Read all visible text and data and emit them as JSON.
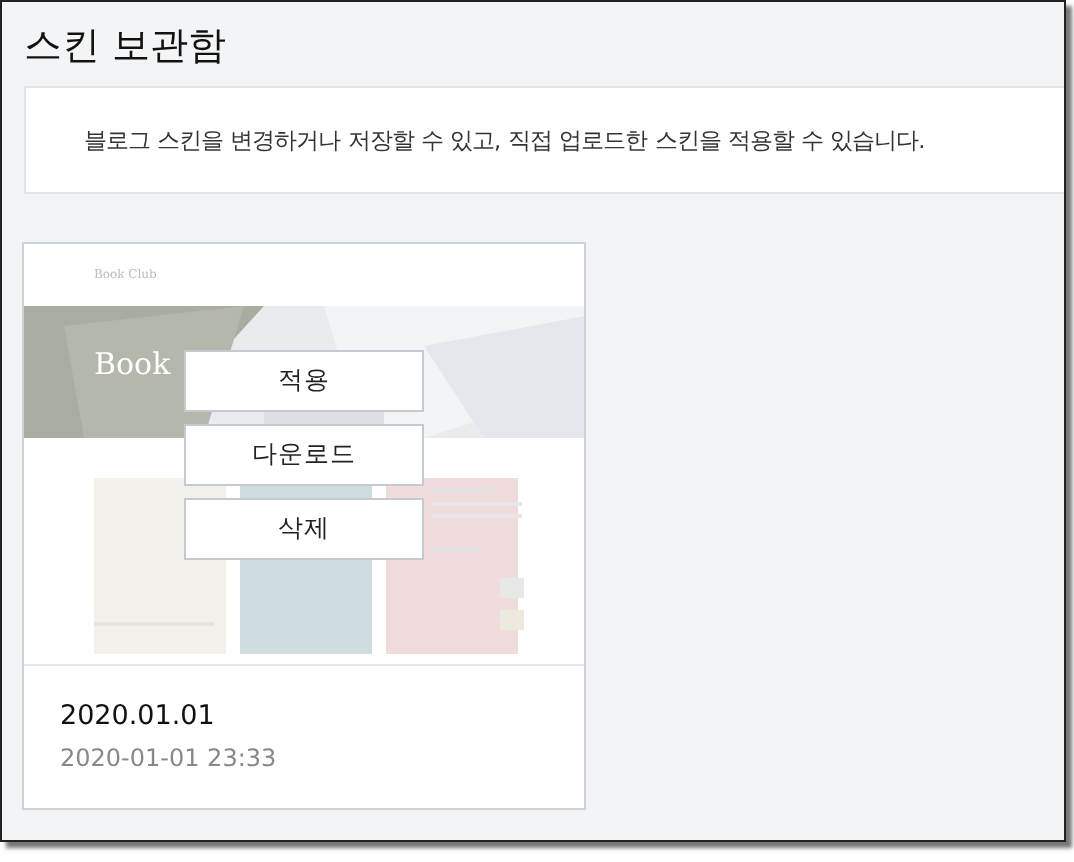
{
  "title": "스킨 보관함",
  "description": "블로그 스킨을 변경하거나 저장할 수 있고, 직접 업로드한 스킨을 적용할 수 있습니다.",
  "skins": [
    {
      "preview": {
        "site_title": "Book Club",
        "hero_text": "Book"
      },
      "actions": [
        "적용",
        "다운로드",
        "삭제"
      ],
      "name": "2020.01.01",
      "date": "2020-01-01 23:33"
    }
  ]
}
